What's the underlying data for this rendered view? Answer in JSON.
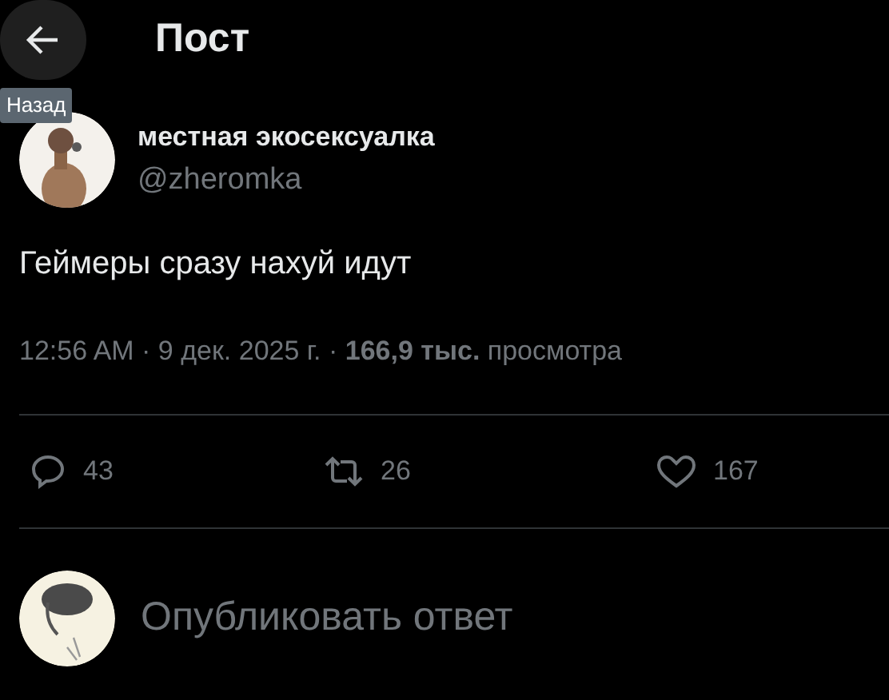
{
  "header": {
    "title": "Пост",
    "back_tooltip": "Назад"
  },
  "post": {
    "author_name": "местная экосексуалка",
    "handle": "@zheromka",
    "text": "Геймеры сразу нахуй идут",
    "meta": "12:56 AM · 9 дек. 2025 г. · **166,9 тыс.** просмотра"
  },
  "actions": [
    {
      "kind": "reply",
      "count": "43"
    },
    {
      "kind": "repost",
      "count": "26"
    },
    {
      "kind": "like",
      "count": "167"
    }
  ],
  "reply_box": {
    "placeholder": "Опубликовать ответ"
  }
}
